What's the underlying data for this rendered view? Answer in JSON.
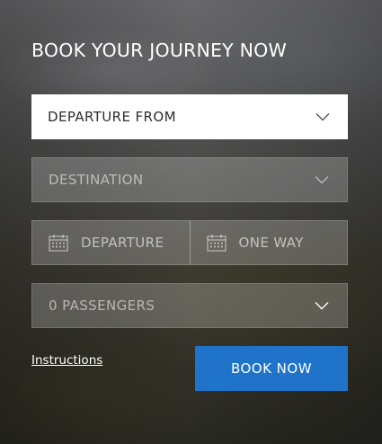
{
  "form": {
    "title": "BOOK YOUR JOURNEY NOW",
    "departure_from": "DEPARTURE FROM",
    "destination": "DESTINATION",
    "departure_date": "DEPARTURE",
    "return_date": "ONE WAY",
    "passengers": "0 PASSENGERS",
    "instructions_link": "Instructions",
    "book_button": "BOOK NOW"
  },
  "icons": {
    "dropdown": "chevron-down-icon",
    "date": "calendar-icon"
  },
  "colors": {
    "accent": "#1f73c9",
    "field_active": "#ffffff",
    "text_dark": "#2e2e2e"
  }
}
